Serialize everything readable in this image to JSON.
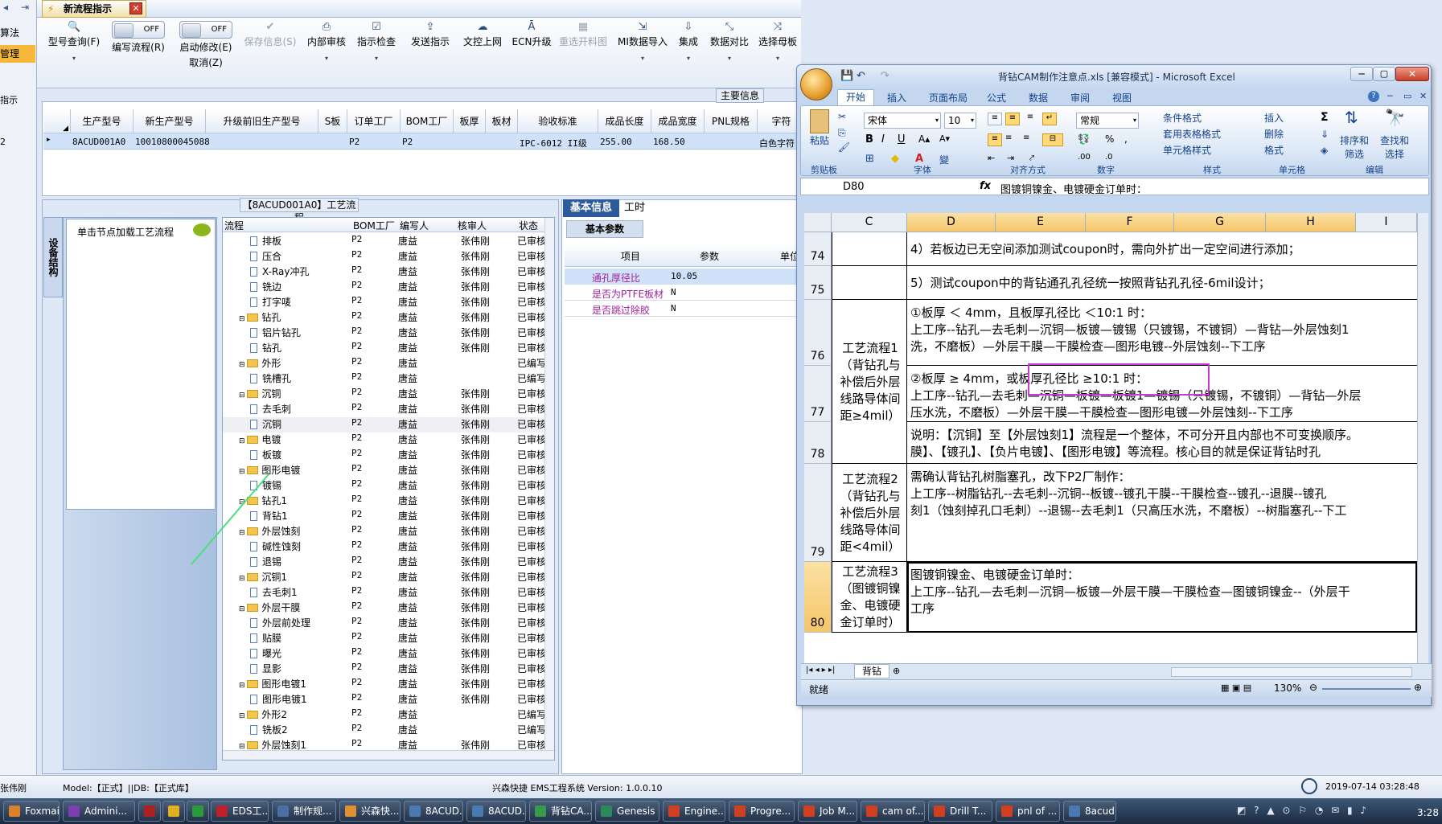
{
  "left_nav": {
    "items": [
      "算法",
      "管理"
    ],
    "mini": [
      "指示",
      "2"
    ]
  },
  "tab": {
    "title": "新流程指示"
  },
  "toolbar": {
    "buttons": [
      {
        "label": "型号查询(F)"
      },
      {
        "label": "编写流程(R)",
        "toggle": "OFF"
      },
      {
        "label": "启动修改(E)",
        "toggle": "OFF",
        "sub": "取消(Z)"
      },
      {
        "label": "保存信息(S)"
      },
      {
        "label": "内部审核"
      },
      {
        "label": "指示检查"
      },
      {
        "label": "发送指示"
      },
      {
        "label": "文控上网"
      },
      {
        "label": "ECN升级"
      },
      {
        "label": "重选开料图"
      },
      {
        "label": "MI数据导入"
      },
      {
        "label": "集成"
      },
      {
        "label": "数据对比"
      },
      {
        "label": "选择母板"
      }
    ]
  },
  "main_info": {
    "title": "主要信息",
    "columns": [
      "生产型号",
      "新生产型号",
      "升级前旧生产型号",
      "S板",
      "订单工厂",
      "BOM工厂",
      "板厚",
      "板材",
      "验收标准",
      "成品长度",
      "成品宽度",
      "PNL规格",
      "字符"
    ],
    "row": [
      "8ACUD001A0",
      "10010800045088",
      "",
      "",
      "P2",
      "P2",
      "",
      "",
      "IPC-6012 II级",
      "255.00",
      "168.50",
      "",
      "白色字符"
    ]
  },
  "process": {
    "title": "【8ACUD001A0】工艺流程",
    "side_tab": "设备结构",
    "hint": "单击节点加载工艺流程",
    "columns": [
      "流程",
      "BOM工厂",
      "编写人",
      "核审人",
      "状态"
    ],
    "rows": [
      {
        "name": "排板",
        "type": "doc",
        "level": 2,
        "bom": "P2",
        "writer": "唐益",
        "reviewer": "张伟刚",
        "status": "已审核"
      },
      {
        "name": "压合",
        "type": "doc",
        "level": 2,
        "bom": "P2",
        "writer": "唐益",
        "reviewer": "张伟刚",
        "status": "已审核"
      },
      {
        "name": "X-Ray冲孔",
        "type": "doc",
        "level": 2,
        "bom": "P2",
        "writer": "唐益",
        "reviewer": "张伟刚",
        "status": "已审核"
      },
      {
        "name": "铣边",
        "type": "doc",
        "level": 2,
        "bom": "P2",
        "writer": "唐益",
        "reviewer": "张伟刚",
        "status": "已审核"
      },
      {
        "name": "打字唛",
        "type": "doc",
        "level": 2,
        "bom": "P2",
        "writer": "唐益",
        "reviewer": "张伟刚",
        "status": "已审核"
      },
      {
        "name": "钻孔",
        "type": "folder",
        "level": 1,
        "bom": "P2",
        "writer": "唐益",
        "reviewer": "张伟刚",
        "status": "已审核"
      },
      {
        "name": "铝片钻孔",
        "type": "doc",
        "level": 2,
        "bom": "P2",
        "writer": "唐益",
        "reviewer": "张伟刚",
        "status": "已审核"
      },
      {
        "name": "钻孔",
        "type": "doc",
        "level": 2,
        "bom": "P2",
        "writer": "唐益",
        "reviewer": "张伟刚",
        "status": "已审核"
      },
      {
        "name": "外形",
        "type": "folder",
        "level": 1,
        "bom": "P2",
        "writer": "唐益",
        "reviewer": "",
        "status": "已编写"
      },
      {
        "name": "铣槽孔",
        "type": "doc",
        "level": 2,
        "bom": "P2",
        "writer": "唐益",
        "reviewer": "",
        "status": "已编写"
      },
      {
        "name": "沉铜",
        "type": "folder",
        "level": 1,
        "bom": "P2",
        "writer": "唐益",
        "reviewer": "张伟刚",
        "status": "已审核"
      },
      {
        "name": "去毛刺",
        "type": "doc",
        "level": 2,
        "bom": "P2",
        "writer": "唐益",
        "reviewer": "张伟刚",
        "status": "已审核"
      },
      {
        "name": "沉铜",
        "type": "doc",
        "level": 2,
        "bom": "P2",
        "writer": "唐益",
        "reviewer": "张伟刚",
        "status": "已审核"
      },
      {
        "name": "电镀",
        "type": "folder",
        "level": 1,
        "bom": "P2",
        "writer": "唐益",
        "reviewer": "张伟刚",
        "status": "已审核"
      },
      {
        "name": "板镀",
        "type": "doc",
        "level": 2,
        "bom": "P2",
        "writer": "唐益",
        "reviewer": "张伟刚",
        "status": "已审核"
      },
      {
        "name": "图形电镀",
        "type": "folder",
        "level": 1,
        "bom": "P2",
        "writer": "唐益",
        "reviewer": "张伟刚",
        "status": "已审核"
      },
      {
        "name": "镀锡",
        "type": "doc",
        "level": 2,
        "bom": "P2",
        "writer": "唐益",
        "reviewer": "张伟刚",
        "status": "已审核"
      },
      {
        "name": "钻孔1",
        "type": "folder",
        "level": 1,
        "bom": "P2",
        "writer": "唐益",
        "reviewer": "张伟刚",
        "status": "已审核"
      },
      {
        "name": "背钻1",
        "type": "doc",
        "level": 2,
        "bom": "P2",
        "writer": "唐益",
        "reviewer": "张伟刚",
        "status": "已审核"
      },
      {
        "name": "外层蚀刻",
        "type": "folder",
        "level": 1,
        "bom": "P2",
        "writer": "唐益",
        "reviewer": "张伟刚",
        "status": "已审核"
      },
      {
        "name": "碱性蚀刻",
        "type": "doc",
        "level": 2,
        "bom": "P2",
        "writer": "唐益",
        "reviewer": "张伟刚",
        "status": "已审核"
      },
      {
        "name": "退锡",
        "type": "doc",
        "level": 2,
        "bom": "P2",
        "writer": "唐益",
        "reviewer": "张伟刚",
        "status": "已审核"
      },
      {
        "name": "沉铜1",
        "type": "folder",
        "level": 1,
        "bom": "P2",
        "writer": "唐益",
        "reviewer": "张伟刚",
        "status": "已审核"
      },
      {
        "name": "去毛刺1",
        "type": "doc",
        "level": 2,
        "bom": "P2",
        "writer": "唐益",
        "reviewer": "张伟刚",
        "status": "已审核"
      },
      {
        "name": "外层干膜",
        "type": "folder",
        "level": 1,
        "bom": "P2",
        "writer": "唐益",
        "reviewer": "张伟刚",
        "status": "已审核"
      },
      {
        "name": "外层前处理",
        "type": "doc",
        "level": 2,
        "bom": "P2",
        "writer": "唐益",
        "reviewer": "张伟刚",
        "status": "已审核"
      },
      {
        "name": "贴膜",
        "type": "doc",
        "level": 2,
        "bom": "P2",
        "writer": "唐益",
        "reviewer": "张伟刚",
        "status": "已审核"
      },
      {
        "name": "曝光",
        "type": "doc",
        "level": 2,
        "bom": "P2",
        "writer": "唐益",
        "reviewer": "张伟刚",
        "status": "已审核"
      },
      {
        "name": "显影",
        "type": "doc",
        "level": 2,
        "bom": "P2",
        "writer": "唐益",
        "reviewer": "张伟刚",
        "status": "已审核"
      },
      {
        "name": "图形电镀1",
        "type": "folder",
        "level": 1,
        "bom": "P2",
        "writer": "唐益",
        "reviewer": "张伟刚",
        "status": "已审核"
      },
      {
        "name": "图形电镀1",
        "type": "doc",
        "level": 2,
        "bom": "P2",
        "writer": "唐益",
        "reviewer": "张伟刚",
        "status": "已审核"
      },
      {
        "name": "外形2",
        "type": "folder",
        "level": 1,
        "bom": "P2",
        "writer": "唐益",
        "reviewer": "",
        "status": "已编写"
      },
      {
        "name": "铣板2",
        "type": "doc",
        "level": 2,
        "bom": "P2",
        "writer": "唐益",
        "reviewer": "",
        "status": "已编写"
      },
      {
        "name": "外层蚀刻1",
        "type": "folder",
        "level": 1,
        "bom": "P2",
        "writer": "唐益",
        "reviewer": "张伟刚",
        "status": "已审核"
      }
    ]
  },
  "detail": {
    "tabs": [
      "基本信息",
      "工时"
    ],
    "subtab": "基本参数",
    "columns": [
      "项目",
      "参数",
      "单位"
    ],
    "rows": [
      {
        "item": "通孔厚径比",
        "value": "10.05"
      },
      {
        "item": "是否为PTFE板材",
        "value": "N"
      },
      {
        "item": "是否跳过除胶",
        "value": "N"
      }
    ]
  },
  "statusbar": {
    "user": "张伟刚",
    "model": "Model:【正式】||DB:【正式库】",
    "system": "兴森快捷 EMS工程系统 Version: 1.0.0.10",
    "datetime": "2019-07-14 03:28:48"
  },
  "excel": {
    "title": "背钻CAM制作注意点.xls [兼容模式] - Microsoft Excel",
    "menu": [
      "开始",
      "插入",
      "页面布局",
      "公式",
      "数据",
      "审阅",
      "视图"
    ],
    "groups": [
      "剪贴板",
      "字体",
      "对齐方式",
      "数字",
      "样式",
      "单元格",
      "编辑"
    ],
    "paste": "粘贴",
    "font_name": "宋体",
    "font_size": "10",
    "number_format": "常规",
    "style_btns": [
      "条件格式",
      "套用表格格式",
      "单元格样式"
    ],
    "cell_btns": [
      "插入",
      "删除",
      "格式"
    ],
    "edit_btns": [
      "排序和筛选",
      "查找和选择"
    ],
    "name_box": "D80",
    "formula": "图镀铜镍金、电镀硬金订单时：",
    "col_headers": [
      "C",
      "D",
      "E",
      "F",
      "G",
      "H",
      "I"
    ],
    "rows": [
      {
        "num": "74",
        "c": "",
        "d": [
          "4）若板边已无空间添加测试coupon时，需向外扩出一定空间进行添加；"
        ]
      },
      {
        "num": "75",
        "c": "",
        "d": [
          "5）测试coupon中的背钻通孔孔径统一按照背钻孔孔径-6mil设计；"
        ]
      },
      {
        "num": "76",
        "c": "",
        "d": [
          "①板厚 ＜ 4mm，且板厚孔径比 ＜10:1 时：",
          "上工序--钻孔—去毛刺—沉铜—板镀—镀锡（只镀锡，不镀铜）—背钻—外层蚀刻1",
          "洗，不磨板）—外层干膜—干膜检查—图形电镀--外层蚀刻--下工序"
        ]
      },
      {
        "num": "77",
        "c": "",
        "d": [
          "②板厚 ≥ 4mm，或板厚孔径比 ≥10:1 时：",
          "上工序--钻孔—去毛刺—沉铜—板镀—板镀1—镀锡（只镀锡，不镀铜）—背钻—外层",
          "压水洗，不磨板）—外层干膜—干膜检查—图形电镀—外层蚀刻--下工序"
        ]
      },
      {
        "num": "78",
        "c": "",
        "d": [
          "说明：【沉铜】至【外层蚀刻1】流程是一个整体，不可分开且内部也不可变换顺序。",
          "膜】、【镀孔】、【负片电镀】、【图形电镀】等流程。核心目的就是保证背钻时孔"
        ]
      },
      {
        "num": "79",
        "c": "工艺流程2（背钻孔与补偿后外层线路导体间距<4mil）",
        "d": [
          "需确认背钻孔树脂塞孔，改下P2厂制作：",
          "上工序--树脂钻孔--去毛刺--沉铜--板镀--镀孔干膜--干膜检查--镀孔--退膜--镀孔",
          "刻1（蚀刻掉孔口毛刺）--退锡--去毛刺1（只高压水洗，不磨板）--树脂塞孔--下工"
        ]
      },
      {
        "num": "80",
        "c": "工艺流程3（图镀铜镍金、电镀硬金订单时）",
        "d": [
          "图镀铜镍金、电镀硬金订单时：",
          "上工序--钻孔—去毛刺—沉铜—板镀—外层干膜—干膜检查—图镀铜镍金--（外层干",
          "工序"
        ]
      }
    ],
    "merged_c_76_78": "工艺流程1（背钻孔与补偿后外层线路导体间距≥4mil）",
    "c_lines": {
      "p1": [
        "工艺流程1",
        "（背钻孔与",
        "补偿后外层",
        "线路导体间",
        "距≥4mil）"
      ],
      "p2": [
        "工艺流程2",
        "（背钻孔与",
        "补偿后外层",
        "线路导体间",
        "距<4mil）"
      ],
      "p3": [
        "工艺流程3",
        "（图镀铜镍",
        "金、电镀硬",
        "金订单时）"
      ]
    },
    "sheet_tab": "背钻",
    "status": "就绪",
    "zoom": "130%"
  },
  "taskbar": {
    "items": [
      "Foxmail",
      "Admini...",
      "",
      "",
      "",
      "EDS工...",
      "制作规...",
      "兴森快...",
      "8ACUD...",
      "8ACUD...",
      "背钻CA...",
      "Genesis",
      "Engine...",
      "Progre...",
      "Job M...",
      "cam of...",
      "Drill T...",
      "pnl of ...",
      "8acud..."
    ],
    "clock": "3:28"
  }
}
